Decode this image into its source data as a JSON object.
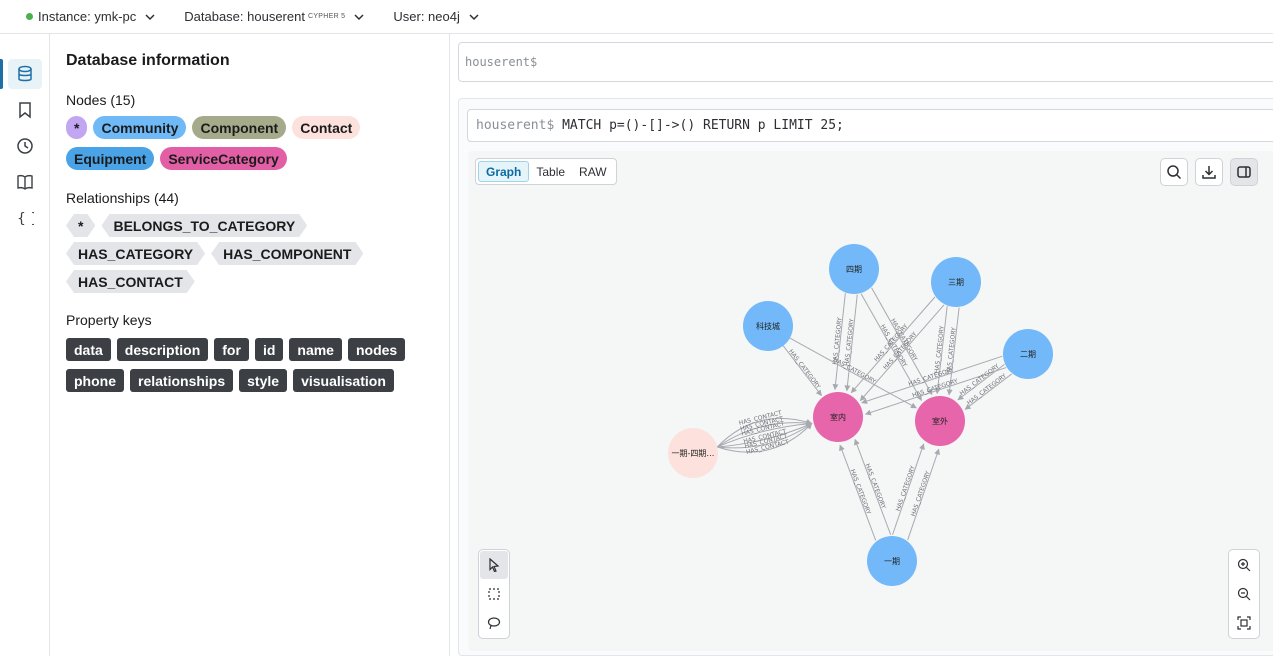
{
  "topbar": {
    "instance_label": "Instance: ymk-pc",
    "database_label": "Database: houserent",
    "database_badge": "CYPHER 5",
    "user_label": "User: neo4j"
  },
  "info": {
    "title": "Database information",
    "nodes_title": "Nodes (15)",
    "node_labels": [
      {
        "label": "*",
        "color": "#c3a6f2"
      },
      {
        "label": "Community",
        "color": "#6fb9f6"
      },
      {
        "label": "Component",
        "color": "#a5ab8a"
      },
      {
        "label": "Contact",
        "color": "#fde1dc"
      },
      {
        "label": "Equipment",
        "color": "#4aa3e6"
      },
      {
        "label": "ServiceCategory",
        "color": "#e35fa5"
      }
    ],
    "relationships_title": "Relationships (44)",
    "relationship_types": [
      "*",
      "BELONGS_TO_CATEGORY",
      "HAS_CATEGORY",
      "HAS_COMPONENT",
      "HAS_CONTACT"
    ],
    "property_keys_title": "Property keys",
    "property_keys": [
      "data",
      "description",
      "for",
      "id",
      "name",
      "nodes",
      "phone",
      "relationships",
      "style",
      "visualisation"
    ]
  },
  "editor": {
    "placeholder": "houserent$"
  },
  "result": {
    "prompt": "houserent$",
    "query": "MATCH p=()-[]->() RETURN p LIMIT 25;",
    "tabs": [
      "Graph",
      "Table",
      "RAW"
    ]
  },
  "graph": {
    "nodes": [
      {
        "id": "n4",
        "label": "四期",
        "color": "#73b9f9"
      },
      {
        "id": "n3",
        "label": "三期",
        "color": "#73b9f9"
      },
      {
        "id": "nk",
        "label": "科技城",
        "color": "#73b9f9"
      },
      {
        "id": "n2",
        "label": "二期",
        "color": "#73b9f9"
      },
      {
        "id": "in",
        "label": "室内",
        "color": "#e665ab"
      },
      {
        "id": "out",
        "label": "室外",
        "color": "#e665ab"
      },
      {
        "id": "c",
        "label": "一期-四期…",
        "color": "#fde1dc"
      },
      {
        "id": "n1",
        "label": "一期",
        "color": "#73b9f9"
      }
    ],
    "edge_label_category": "HAS_CATEGORY",
    "edge_label_contact": "HAS_CONTACT"
  },
  "icons": {
    "rail": [
      "database-icon",
      "bookmark-icon",
      "history-icon",
      "book-icon",
      "braces-icon"
    ]
  }
}
